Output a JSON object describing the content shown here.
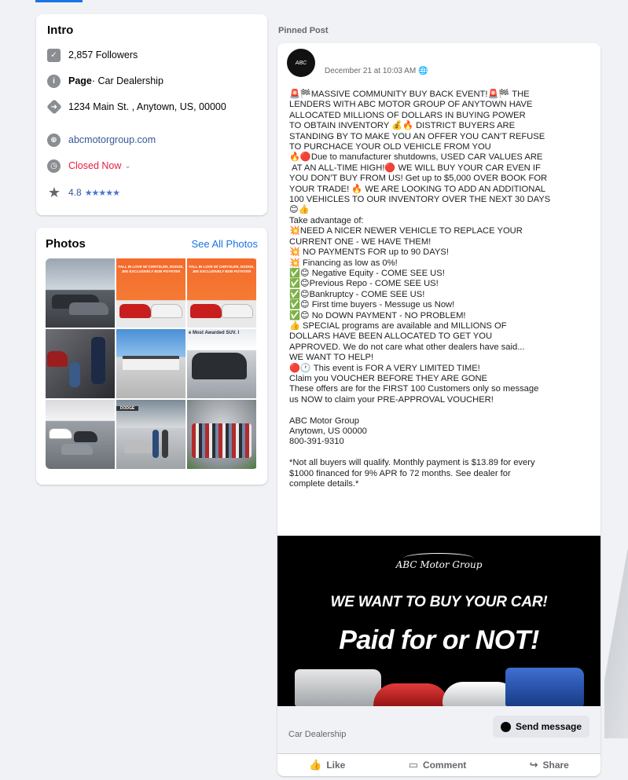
{
  "intro": {
    "title": "Intro",
    "followers": "2,857 Followers",
    "page_label": "Page",
    "page_category": " · Car Dealership",
    "address": "1234 Main St. , Anytown, US, 00000",
    "website": "abcmotorgroup.com",
    "status": "Closed Now",
    "rating": "4.8",
    "stars": "★★★★★"
  },
  "photos": {
    "title": "Photos",
    "see_all": "See All Photos",
    "tile_text_1": "FALL IN LOVE W/ CHRYSLER, DODGE, JEE EXCLUSIVELY BOB POYNTER",
    "tile_text_2": "FALL IN LOVE W/ CHRYSLER, DODGE, JEE EXCLUSIVELY BOB POYNTER",
    "tile_text_3": "e Most Awarded SUV. I",
    "tile_text_4": "DODGE"
  },
  "post": {
    "pinned_label": "Pinned Post",
    "avatar_text": "ABC",
    "date": "December 21 at 10:03 AM 🌐",
    "body": "🚨🏁MASSIVE COMMUNITY BUY BACK EVENT!🚨🏁 THE\nLENDERS WITH ABC MOTOR GROUP OF ANYTOWN HAVE\nALLOCATED MILLIONS OF DOLLARS IN BUYING POWER\nTO OBTAIN INVENTORY 💰🔥 DISTRICT BUYERS ARE\nSTANDING BY TO MAKE YOU AN OFFER YOU CAN'T REFUSE\nTO PURCHACE YOUR OLD VEHICLE FROM YOU\n🔥🔴Due to manufacturer shutdowns, USED CAR VALUES ARE\n AT AN ALL-TIME HIGH!🔴 WE WILL BUY YOUR CAR EVEN IF\nYOU DON'T BUY FROM US! Get up to $5,000 OVER BOOK FOR\nYOUR TRADE! 🔥 WE ARE LOOKING TO ADD AN ADDITIONAL\n100 VEHICLES TO OUR INVENTORY OVER THE NEXT 30 DAYS\n😊👍\nTake advantage of:\n💥NEED A NICER NEWER VEHICLE TO REPLACE YOUR\nCURRENT ONE - WE HAVE THEM!\n💥 NO PAYMENTS FOR up to 90 DAYS!\n💥 Financing as low as 0%!\n✅😊 Negative Equity - COME SEE US!\n✅😊Previous Repo - COME SEE US!\n✅😊Bankruptcy - COME SEE US!\n✅😊 First time buyers - Messuge us Now!\n✅😊 No DOWN PAYMENT - NO PROBLEM!\n👍 SPECIAL programs are available and MILLIONS OF\nDOLLARS HAVE BEEN ALLOCATED TO GET YOU\nAPPROVED. We do not care what other dealers have said...\nWE WANT TO HELP!\n🔴🕐 This event is FOR A VERY LIMITED TIME!\nClaim you VOUCHER BEFORE THEY ARE GONE\nThese offers are for the FIRST 100 Customers only so message\nus NOW to claim your PRE-APPROVAL VOUCHER!\n\nABC Motor Group\nAnytown, US 00000\n800-391-9310\n\n*Not all buyers will qualify. Monthly payment is $13.89 for every\n$1000 financed for 9% APR fo 72 months. See dealer for\ncomplete details.*",
    "banner_logo": "ABC Motor Group",
    "banner_line1": "WE WANT TO BUY YOUR CAR!",
    "banner_line2": "Paid for or NOT!",
    "footer_category": "Car Dealership",
    "send_message": "Send message",
    "like": "Like",
    "comment": "Comment",
    "share": "Share"
  },
  "colors": {
    "accent": "#1b74e4",
    "link": "#385898",
    "closed": "#e41e3f",
    "background": "#f0f2f5"
  },
  "icons": {
    "followers": "followers-icon",
    "page": "info-icon",
    "address": "directions-icon",
    "website": "globe-icon",
    "hours": "clock-icon",
    "rating": "star-icon",
    "like": "thumbs-up-icon",
    "comment": "comment-icon",
    "share": "share-icon",
    "messenger": "messenger-icon"
  }
}
